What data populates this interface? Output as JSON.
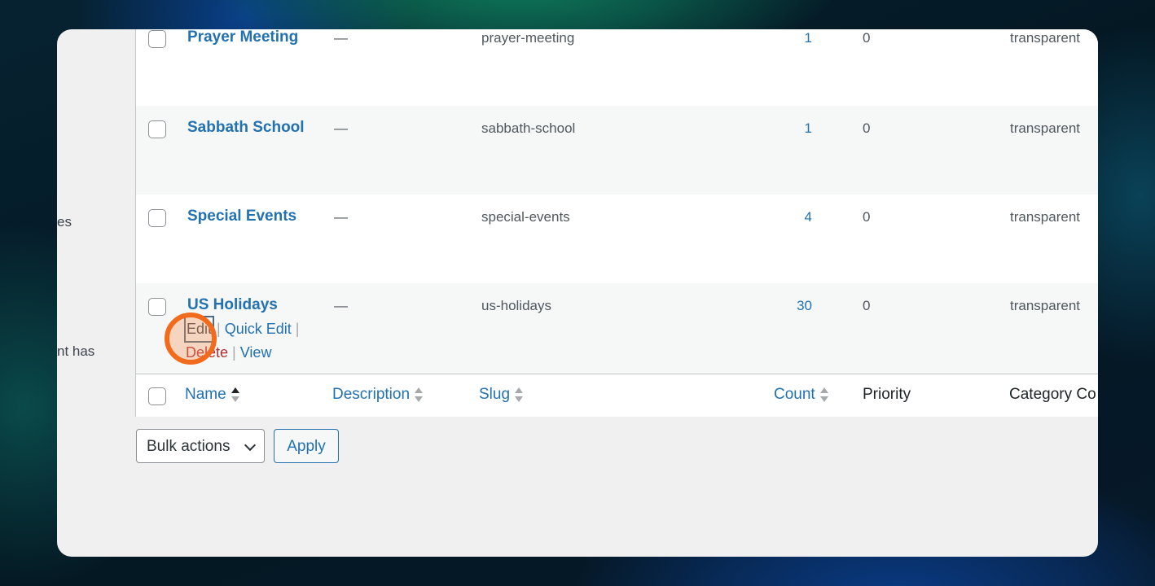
{
  "sidebar_fragments": [
    "es",
    "nt has"
  ],
  "rows": [
    {
      "name": "Prayer Meeting",
      "description": "—",
      "slug": "prayer-meeting",
      "count": "1",
      "priority": "0",
      "category_color": "transparent"
    },
    {
      "name": "Sabbath School",
      "description": "—",
      "slug": "sabbath-school",
      "count": "1",
      "priority": "0",
      "category_color": "transparent"
    },
    {
      "name": "Special Events",
      "description": "—",
      "slug": "special-events",
      "count": "4",
      "priority": "0",
      "category_color": "transparent"
    },
    {
      "name": "US Holidays",
      "description": "—",
      "slug": "us-holidays",
      "count": "30",
      "priority": "0",
      "category_color": "transparent"
    }
  ],
  "row_actions": {
    "edit": "Edit",
    "quick_edit": "Quick Edit",
    "delete": "Delete",
    "view": "View",
    "separator": "|"
  },
  "columns": {
    "name": "Name",
    "description": "Description",
    "slug": "Slug",
    "count": "Count",
    "priority": "Priority",
    "category_color": "Category Co"
  },
  "bulk_actions": {
    "label": "Bulk actions",
    "apply": "Apply"
  },
  "colors": {
    "link": "#2271b1",
    "delete": "#b32d2e",
    "click_indicator": "#f26b1d"
  }
}
